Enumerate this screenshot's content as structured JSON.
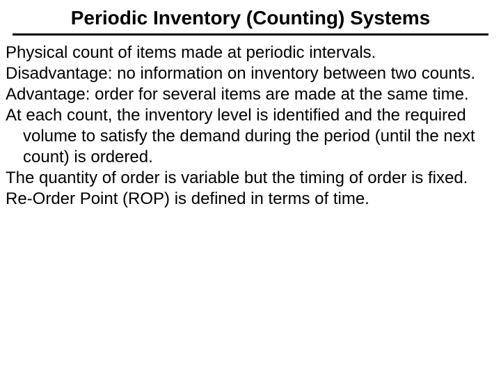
{
  "title": "Periodic Inventory (Counting)  Systems",
  "paragraphs": {
    "p1": "Physical count of items made at periodic intervals.",
    "p2": "Disadvantage:  no information on inventory between two counts.",
    "p3": "Advantage: order for several items are made at the same time.",
    "p4": "At each count, the inventory level is identified and the required volume to satisfy the demand during the period (until the next count)  is ordered.",
    "p5": "The quantity of order is variable but the timing of order is fixed.",
    "p6": "Re-Order Point (ROP) is defined in terms of time."
  }
}
